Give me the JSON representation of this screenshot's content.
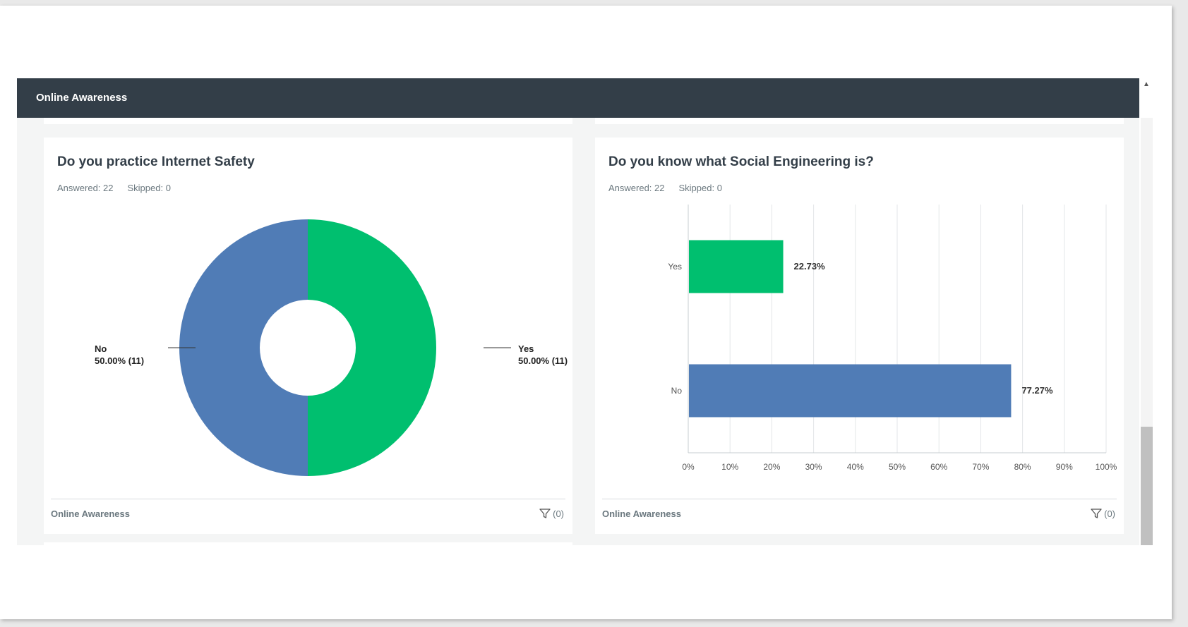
{
  "header": {
    "title": "Online Awareness"
  },
  "colors": {
    "yes": "#00bf6f",
    "no": "#507cb6",
    "header_bg": "#333e48"
  },
  "panels": [
    {
      "title": "Do you practice Internet Safety",
      "answered": "Answered: 22",
      "skipped": "Skipped: 0",
      "footer_label": "Online Awareness",
      "filter_count": "(0)",
      "labels": {
        "no_name": "No",
        "no_value": "50.00% (11)",
        "yes_name": "Yes",
        "yes_value": "50.00% (11)"
      },
      "chart_data": {
        "type": "pie",
        "style": "donut",
        "slices": [
          {
            "label": "Yes",
            "percent": 50.0,
            "count": 11,
            "color": "#00bf6f"
          },
          {
            "label": "No",
            "percent": 50.0,
            "count": 11,
            "color": "#507cb6"
          }
        ]
      }
    },
    {
      "title": "Do you know what Social Engineering is?",
      "answered": "Answered: 22",
      "skipped": "Skipped: 0",
      "footer_label": "Online Awareness",
      "filter_count": "(0)",
      "chart_data": {
        "type": "bar",
        "orientation": "horizontal",
        "categories": [
          "Yes",
          "No"
        ],
        "values": [
          22.73,
          77.27
        ],
        "value_labels": [
          "22.73%",
          "77.27%"
        ],
        "colors": [
          "#00bf6f",
          "#507cb6"
        ],
        "xlim": [
          0,
          100
        ],
        "xticks": [
          "0%",
          "10%",
          "20%",
          "30%",
          "40%",
          "50%",
          "60%",
          "70%",
          "80%",
          "90%",
          "100%"
        ],
        "grid": true
      }
    }
  ]
}
